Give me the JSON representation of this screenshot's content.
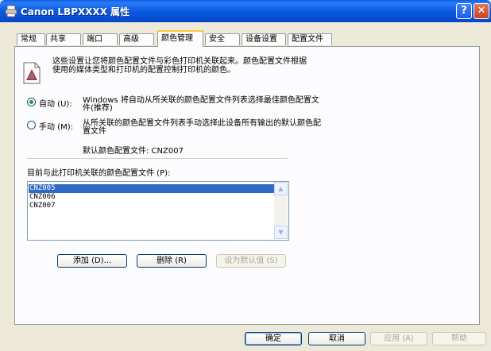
{
  "window": {
    "title": "Canon LBPXXXX 属性",
    "help_label": "?",
    "close_label": "✕"
  },
  "tabs": [
    "常规",
    "共享",
    "端口",
    "高级",
    "颜色管理",
    "安全",
    "设备设置",
    "配置文件"
  ],
  "active_tab": "颜色管理",
  "description": "这些设置让您将颜色配置文件与彩色打印机关联起来。颜色配置文件根据使用的媒体类型和打印机的配置控制打印机的颜色。",
  "auto_option": {
    "label": "自动 (U):",
    "selected": true,
    "description": "Windows 将自动从所关联的颜色配置文件列表选择最佳颜色配置文件(推荐)"
  },
  "manual_option": {
    "label": "手动 (M):",
    "selected": false,
    "description": "从所关联的颜色配置文件列表手动选择此设备所有输出的默认颜色配置文件"
  },
  "default_profile_line": "默认颜色配置文件:  CNZ007",
  "profiles_label": "目前与此打印机关联的颜色配置文件 (P):",
  "profiles": [
    "CNZ005",
    "CNZ006",
    "CNZ007"
  ],
  "selected_profile": "CNZ005",
  "buttons": {
    "add": "添加 (D)...",
    "remove": "删除 (R)",
    "set_default": "设为默认值 (S)",
    "ok": "确定",
    "cancel": "取消",
    "apply": "应用 (A)",
    "help": "帮助"
  },
  "icons": {
    "app": "printer-icon",
    "color": "color-profile-icon"
  },
  "colors": {
    "titlebar": "#0A5FE6",
    "background": "#ECE9D8",
    "selection": "#316AC5",
    "active_tab_highlight": "#FFC83C"
  }
}
